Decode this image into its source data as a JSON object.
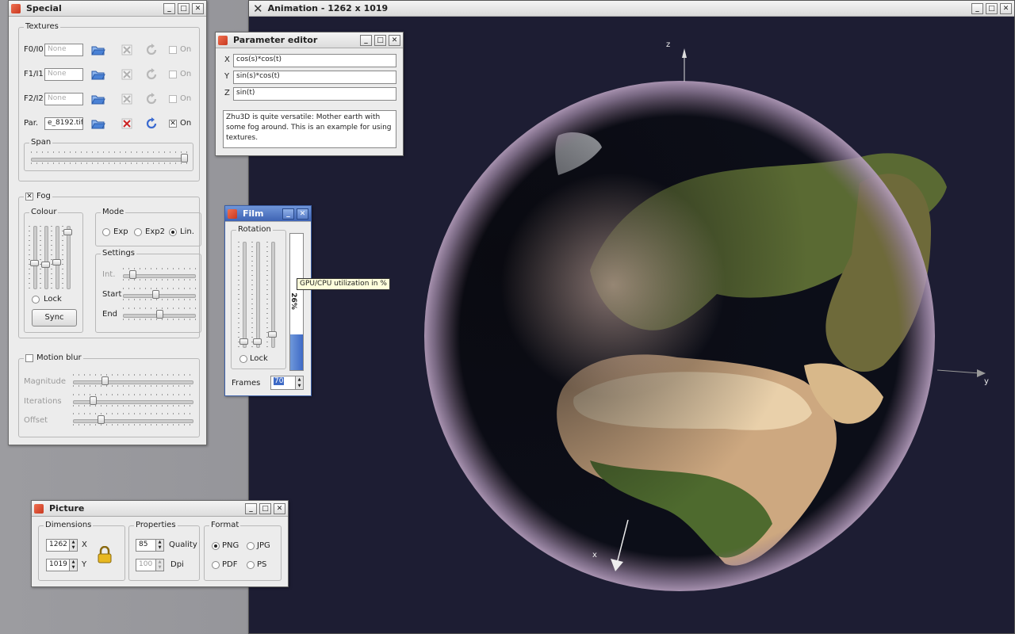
{
  "special": {
    "title": "Special",
    "textures": {
      "legend": "Textures",
      "rows": [
        {
          "label": "F0/I0",
          "value": "None",
          "on": "On",
          "checked": false,
          "enabled": false
        },
        {
          "label": "F1/I1",
          "value": "None",
          "on": "On",
          "checked": false,
          "enabled": false
        },
        {
          "label": "F2/I2",
          "value": "None",
          "on": "On",
          "checked": false,
          "enabled": false
        },
        {
          "label": "Par.",
          "value": "e_8192.tif",
          "on": "On",
          "checked": true,
          "enabled": true
        }
      ],
      "span_label": "Span",
      "span_value": 1.0
    },
    "fog": {
      "label": "Fog",
      "checked": true,
      "colour_label": "Colour",
      "lock": "Lock",
      "sync": "Sync",
      "mode_label": "Mode",
      "modes": [
        "Exp",
        "Exp2",
        "Lin."
      ],
      "mode_selected": "Lin.",
      "settings_label": "Settings",
      "int": "Int.",
      "start": "Start",
      "end": "End",
      "colour_levels": [
        0.4,
        0.38,
        0.42,
        0.95
      ],
      "int_value": 0.1,
      "start_value": 0.45,
      "end_value": 0.5
    },
    "motion_blur": {
      "label": "Motion blur",
      "checked": false,
      "magnitude": "Magnitude",
      "iterations": "Iterations",
      "offset": "Offset",
      "magnitude_value": 0.25,
      "iterations_value": 0.15,
      "offset_value": 0.22
    }
  },
  "param_editor": {
    "title": "Parameter editor",
    "x_label": "X",
    "x": "cos(s)*cos(t)",
    "y_label": "Y",
    "y": "sin(s)*cos(t)",
    "z_label": "Z",
    "z": "sin(t)",
    "description": "Zhu3D is quite versatile: Mother earth with some fog around. This is an example for using textures."
  },
  "film": {
    "title": "Film",
    "rotation": "Rotation",
    "lock": "Lock",
    "frames_label": "Frames",
    "frames": "70",
    "utilization": "26%",
    "tooltip": "GPU/CPU utilization in %",
    "utilization_value": 0.26,
    "rotation_levels": [
      0.03,
      0.03,
      0.1
    ]
  },
  "picture": {
    "title": "Picture",
    "dimensions": "Dimensions",
    "width": "1262",
    "x_label": "X",
    "height": "1019",
    "y_label": "Y",
    "properties": "Properties",
    "quality": "85",
    "quality_label": "Quality",
    "dpi": "100",
    "dpi_label": "Dpi",
    "format": "Format",
    "formats": [
      "PNG",
      "JPG",
      "PDF",
      "PS"
    ],
    "format_selected": "PNG"
  },
  "animation": {
    "title": "Animation - 1262 x 1019",
    "axis_x": "x",
    "axis_y": "y",
    "axis_z": "z",
    "bg_color": "#1d1d33",
    "icon": "x-close-icon"
  },
  "icons": {
    "open": "folder-open-icon",
    "clear": "clear-texture-icon",
    "reload": "reload-icon",
    "lock": "padlock-icon",
    "window": "app-window-icon"
  }
}
